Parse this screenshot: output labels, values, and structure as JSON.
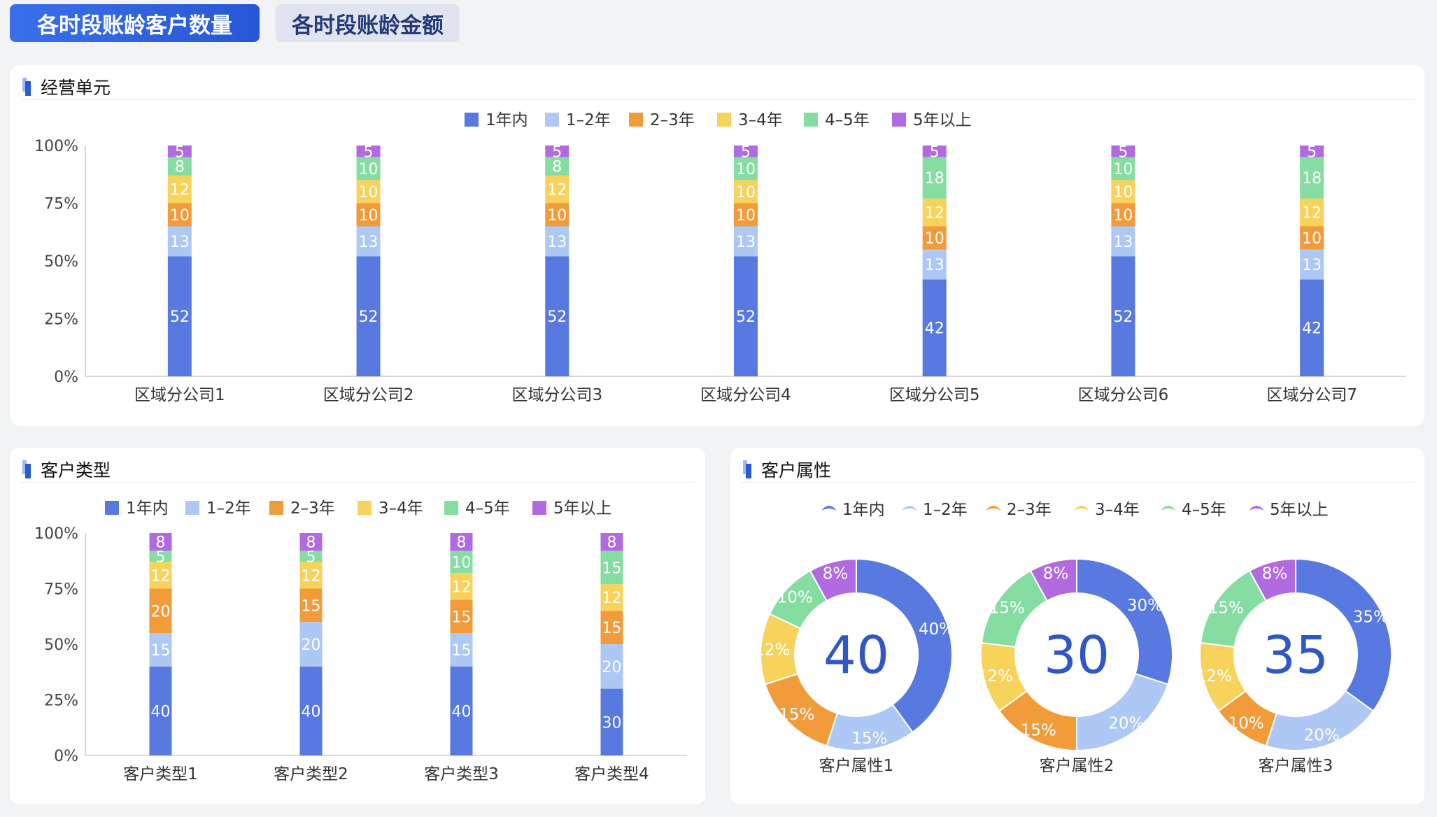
{
  "tabs": [
    {
      "label": "各时段账龄客户数量",
      "active": true
    },
    {
      "label": "各时段账龄金额",
      "active": false
    }
  ],
  "colors": [
    "#5779e0",
    "#adc8f5",
    "#f29b3b",
    "#f7d35b",
    "#85dda1",
    "#b26ae0"
  ],
  "legend": [
    "1年内",
    "1–2年",
    "2–3年",
    "3–4年",
    "4–5年",
    "5年以上"
  ],
  "panels": {
    "unit": {
      "title": "经营单元"
    },
    "type": {
      "title": "客户类型"
    },
    "attr": {
      "title": "客户属性"
    }
  },
  "chart_data": [
    {
      "type": "bar",
      "stacked": true,
      "panel": "unit",
      "y_ticks": [
        "0%",
        "25%",
        "50%",
        "75%",
        "100%"
      ],
      "ylim": [
        0,
        100
      ],
      "categories": [
        "区域分公司1",
        "区域分公司2",
        "区域分公司3",
        "区域分公司4",
        "区域分公司5",
        "区域分公司6",
        "区域分公司7"
      ],
      "series": [
        {
          "name": "1年内",
          "values": [
            52,
            52,
            52,
            52,
            42,
            52,
            42
          ]
        },
        {
          "name": "1–2年",
          "values": [
            13,
            13,
            13,
            13,
            13,
            13,
            13
          ]
        },
        {
          "name": "2–3年",
          "values": [
            10,
            10,
            10,
            10,
            10,
            10,
            10
          ]
        },
        {
          "name": "3–4年",
          "values": [
            12,
            10,
            12,
            10,
            12,
            10,
            12
          ]
        },
        {
          "name": "4–5年",
          "values": [
            8,
            10,
            8,
            10,
            18,
            10,
            18
          ]
        },
        {
          "name": "5年以上",
          "values": [
            5,
            5,
            5,
            5,
            5,
            5,
            5
          ]
        }
      ],
      "legend_position": "top"
    },
    {
      "type": "bar",
      "stacked": true,
      "panel": "type",
      "y_ticks": [
        "0%",
        "25%",
        "50%",
        "75%",
        "100%"
      ],
      "ylim": [
        0,
        100
      ],
      "categories": [
        "客户类型1",
        "客户类型2",
        "客户类型3",
        "客户类型4"
      ],
      "series": [
        {
          "name": "1年内",
          "values": [
            40,
            40,
            40,
            30
          ]
        },
        {
          "name": "1–2年",
          "values": [
            15,
            20,
            15,
            20
          ]
        },
        {
          "name": "2–3年",
          "values": [
            20,
            15,
            15,
            15
          ]
        },
        {
          "name": "3–4年",
          "values": [
            12,
            12,
            12,
            12
          ]
        },
        {
          "name": "4–5年",
          "values": [
            5,
            5,
            10,
            15
          ]
        },
        {
          "name": "5年以上",
          "values": [
            8,
            8,
            8,
            8
          ]
        }
      ],
      "legend_position": "top"
    },
    {
      "type": "pie",
      "donut": true,
      "panel": "attr",
      "legend_position": "top",
      "charts": [
        {
          "label": "客户属性1",
          "center": "40",
          "values": [
            40,
            15,
            15,
            12,
            10,
            8
          ]
        },
        {
          "label": "客户属性2",
          "center": "30",
          "values": [
            30,
            20,
            15,
            12,
            15,
            8
          ]
        },
        {
          "label": "客户属性3",
          "center": "35",
          "values": [
            35,
            20,
            10,
            12,
            15,
            8
          ]
        }
      ]
    }
  ]
}
